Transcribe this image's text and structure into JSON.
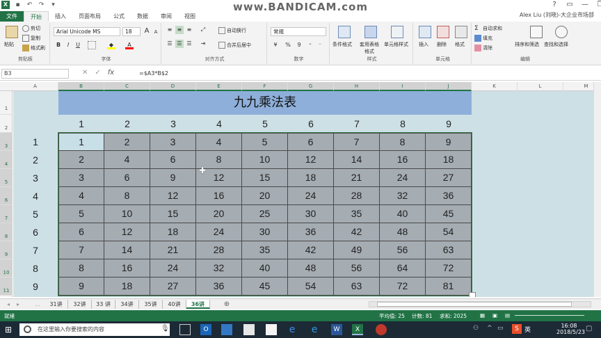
{
  "window": {
    "watermark": "www.BANDICAM.com",
    "user": "Alex Liu (刘晓)-大企业市场部",
    "controls": [
      "?",
      "▭",
      "—",
      "❐",
      "✕"
    ]
  },
  "tabs": [
    "文件",
    "开始",
    "插入",
    "页面布局",
    "公式",
    "数据",
    "审阅",
    "视图"
  ],
  "ribbon": {
    "clipboard": {
      "paste": "粘贴",
      "cut": "剪切",
      "copy": "复制",
      "painter": "格式刷",
      "label": "剪贴板"
    },
    "font": {
      "name": "Arial Unicode MS",
      "size": "18",
      "label": "字体",
      "bold": "B",
      "italic": "I",
      "underline": "U",
      "grow": "A",
      "shrink": "A"
    },
    "align": {
      "wrap": "自动换行",
      "merge": "合并后居中",
      "label": "对齐方式"
    },
    "number": {
      "format": "常规",
      "label": "数字",
      "currency": "¥",
      "percent": "%",
      "comma": "9"
    },
    "styles": {
      "cond": "条件格式",
      "table": "套用表格格式",
      "cell": "单元格样式",
      "label": "样式"
    },
    "cells": {
      "insert": "插入",
      "delete": "删除",
      "format": "格式",
      "label": "单元格"
    },
    "editing": {
      "autosum": "自动求和",
      "fill": "填充",
      "clear": "清除",
      "sort": "排序和筛选",
      "find": "查找和选择",
      "label": "编辑"
    }
  },
  "formula_bar": {
    "name_box": "B3",
    "formula": "=$A3*B$2"
  },
  "columns": [
    "A",
    "B",
    "C",
    "D",
    "E",
    "F",
    "G",
    "H",
    "I",
    "J",
    "K",
    "L",
    "M"
  ],
  "rows": [
    "1",
    "2",
    "3",
    "4",
    "5",
    "6",
    "7",
    "8",
    "9",
    "10",
    "11"
  ],
  "sheet": {
    "title": "九九乘法表",
    "header_row": [
      "1",
      "2",
      "3",
      "4",
      "5",
      "6",
      "7",
      "8",
      "9"
    ],
    "row_labels": [
      "1",
      "2",
      "3",
      "4",
      "5",
      "6",
      "7",
      "8",
      "9"
    ],
    "table": [
      [
        "1",
        "2",
        "3",
        "4",
        "5",
        "6",
        "7",
        "8",
        "9"
      ],
      [
        "2",
        "4",
        "6",
        "8",
        "10",
        "12",
        "14",
        "16",
        "18"
      ],
      [
        "3",
        "6",
        "9",
        "12",
        "15",
        "18",
        "21",
        "24",
        "27"
      ],
      [
        "4",
        "8",
        "12",
        "16",
        "20",
        "24",
        "28",
        "32",
        "36"
      ],
      [
        "5",
        "10",
        "15",
        "20",
        "25",
        "30",
        "35",
        "40",
        "45"
      ],
      [
        "6",
        "12",
        "18",
        "24",
        "30",
        "36",
        "42",
        "48",
        "54"
      ],
      [
        "7",
        "14",
        "21",
        "28",
        "35",
        "42",
        "49",
        "56",
        "63"
      ],
      [
        "8",
        "16",
        "24",
        "32",
        "40",
        "48",
        "56",
        "64",
        "72"
      ],
      [
        "9",
        "18",
        "27",
        "36",
        "45",
        "54",
        "63",
        "72",
        "81"
      ]
    ]
  },
  "sheet_tabs": [
    "31讲",
    "32讲",
    "33 讲",
    "34讲",
    "35讲",
    "40讲",
    "36讲"
  ],
  "active_sheet_tab": "36讲",
  "status": {
    "ready": "就绪",
    "average": "平均值: 25",
    "count": "计数: 81",
    "sum": "求和: 2025"
  },
  "taskbar": {
    "search": "在这里输入你要搜索的内容",
    "time": "16:08",
    "date": "2018/5/23",
    "ime": "英"
  }
}
